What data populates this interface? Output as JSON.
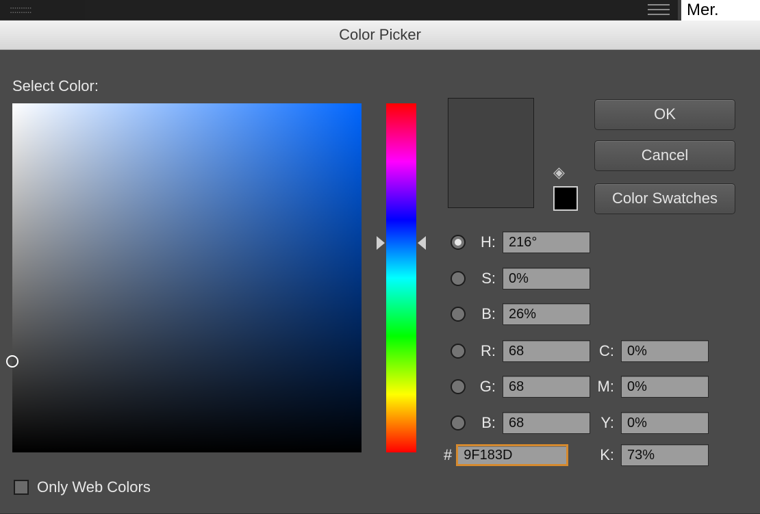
{
  "host": {
    "side_text": "Mer."
  },
  "dialog": {
    "title": "Color Picker",
    "select_label": "Select Color:",
    "only_web_label": "Only Web Colors",
    "only_web_checked": false,
    "buttons": {
      "ok": "OK",
      "cancel": "Cancel",
      "swatches": "Color Swatches"
    },
    "preview": {
      "new_color": "#424242",
      "mini_swatch": "#000000"
    },
    "hue_deg": 216,
    "sb_cursor": {
      "s_pct": 0,
      "b_pct": 26
    },
    "selected_model_radio": "H",
    "fields": {
      "H": {
        "label": "H:",
        "value": "216°"
      },
      "S": {
        "label": "S:",
        "value": "0%"
      },
      "Bb": {
        "label": "B:",
        "value": "26%"
      },
      "R": {
        "label": "R:",
        "value": "68"
      },
      "G": {
        "label": "G:",
        "value": "68"
      },
      "B2": {
        "label": "B:",
        "value": "68"
      },
      "hex_prefix": "#",
      "hex": "9F183D",
      "C": {
        "label": "C:",
        "value": "0%"
      },
      "M": {
        "label": "M:",
        "value": "0%"
      },
      "Y": {
        "label": "Y:",
        "value": "0%"
      },
      "K": {
        "label": "K:",
        "value": "73%"
      }
    }
  }
}
